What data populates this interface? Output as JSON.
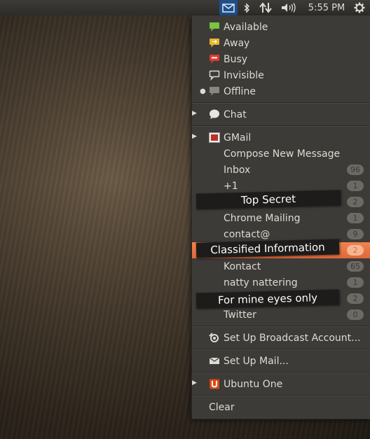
{
  "panel": {
    "clock": "5:55 PM"
  },
  "status": [
    {
      "label": "Available",
      "color": "#7cc243"
    },
    {
      "label": "Away",
      "color": "#e8b62a"
    },
    {
      "label": "Busy",
      "color": "#e03a2e"
    },
    {
      "label": "Invisible",
      "color": "#dfdbd2"
    },
    {
      "label": "Offline",
      "color": "#8a877f"
    }
  ],
  "chat": {
    "label": "Chat"
  },
  "gmail": {
    "label": "GMail",
    "compose": "Compose New Message",
    "folders": [
      {
        "label": "Inbox",
        "count": "96"
      },
      {
        "label": "+1",
        "count": "1"
      },
      {
        "label": "",
        "count": "2"
      },
      {
        "label": "Chrome Mailing",
        "count": "1"
      },
      {
        "label": "contact@",
        "count": "9"
      },
      {
        "label": "",
        "count": "2"
      },
      {
        "label": "Kontact",
        "count": "65"
      },
      {
        "label": "natty nattering",
        "count": "1"
      },
      {
        "label": "",
        "count": "2"
      },
      {
        "label": "Twitter",
        "count": "0"
      }
    ]
  },
  "setup_broadcast": "Set Up Broadcast Account...",
  "setup_mail": "Set Up Mail...",
  "ubuntu_one": "Ubuntu One",
  "clear": "Clear",
  "redactions": [
    "Top Secret",
    "Classified Information",
    "For mine eyes only"
  ]
}
